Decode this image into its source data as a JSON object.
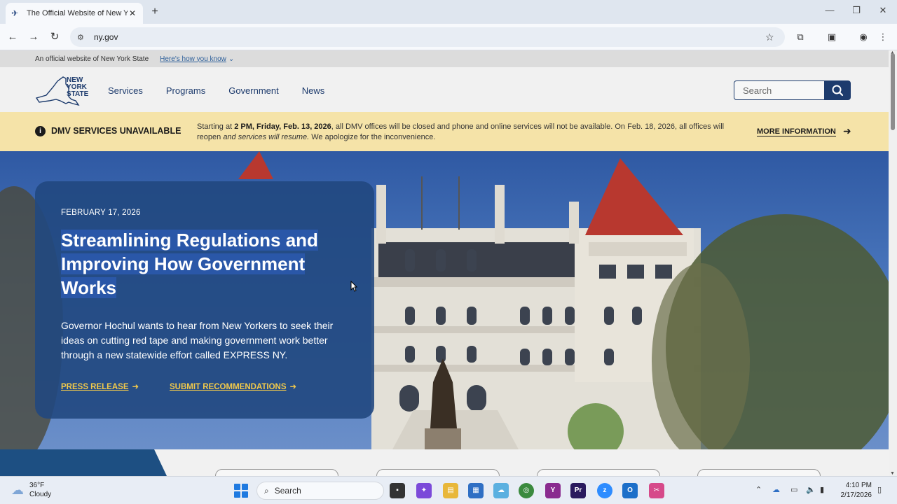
{
  "browser": {
    "tab_title": "The Official Website of New York State",
    "new_tab_label": "+",
    "url": "ny.gov",
    "window_controls": {
      "minimize": "—",
      "maximize": "❐",
      "close": "✕"
    }
  },
  "site": {
    "official_notice": "An official website of New York State",
    "how_you_know": "Here's how you know",
    "logo_text": [
      "NEW",
      "YORK",
      "STATE"
    ],
    "nav": [
      "Services",
      "Programs",
      "Government",
      "News"
    ],
    "search_placeholder": "Search"
  },
  "alert": {
    "title": "DMV SERVICES UNAVAILABLE",
    "text_bold_1": "2 PM, Friday, Feb. 13, 2026",
    "text_prefix": "Starting at ",
    "text_mid": ", all DMV offices will be closed and phone and online services will not be available. On Feb. 18, 2026, all offices will reopen ",
    "text_italic": "and services will resume.",
    "text_suffix": " We apologize for the inconvenience.",
    "more": "MORE INFORMATION"
  },
  "hero": {
    "date": "FEBRUARY 17, 2026",
    "title_lines": [
      "Streamlining Regulations and",
      "Improving How Government",
      "Works"
    ],
    "description": "Governor Hochul wants to hear from New Yorkers to seek their ideas on cutting red tape and making government work better through a new statewide effort called EXPRESS NY.",
    "link_press": "PRESS RELEASE",
    "link_submit": "SUBMIT RECOMMENDATIONS"
  },
  "taskbar": {
    "weather_temp": "36°F",
    "weather_cond": "Cloudy",
    "search": "Search",
    "time": "4:10 PM",
    "date": "2/17/2026"
  },
  "colors": {
    "navy": "#1d3b6d",
    "alert_bg": "#f5e3a8",
    "link_yellow": "#f1c94b",
    "card_blue": "#214880"
  }
}
